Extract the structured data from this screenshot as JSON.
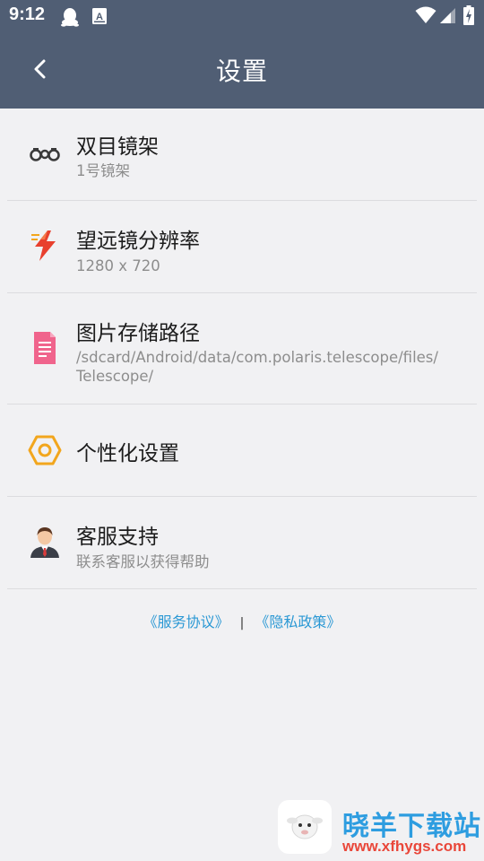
{
  "status_bar": {
    "time": "9:12",
    "left_icons": [
      "qq-icon",
      "notification-a-icon"
    ],
    "right_icons": [
      "wifi-icon",
      "signal-icon",
      "battery-charging-icon"
    ]
  },
  "app_bar": {
    "title": "设置",
    "back_icon": "chevron-left-icon"
  },
  "settings": [
    {
      "icon": "binoculars-icon",
      "title": "双目镜架",
      "subtitle": "1号镜架"
    },
    {
      "icon": "lightning-icon",
      "title": "望远镜分辨率",
      "subtitle": "1280 x 720"
    },
    {
      "icon": "document-icon",
      "title": "图片存储路径",
      "subtitle": "/sdcard/Android/data/com.polaris.telescope/files/Telescope/"
    },
    {
      "icon": "hexagon-settings-icon",
      "title": "个性化设置",
      "subtitle": ""
    },
    {
      "icon": "customer-service-icon",
      "title": "客服支持",
      "subtitle": "联系客服以获得帮助"
    }
  ],
  "links": {
    "service_agreement": "《服务协议》",
    "separator": "|",
    "privacy_policy": "《隐私政策》"
  },
  "watermark": {
    "name": "晓羊下载站",
    "url": "www.xfhygs.com"
  },
  "colors": {
    "header": "#505e74",
    "background": "#f1f1f3",
    "link": "#2a98d4",
    "hexagon_icon": "#f2a61d",
    "lightning_icon": "#e8402e",
    "document_icon": "#f0648c"
  }
}
